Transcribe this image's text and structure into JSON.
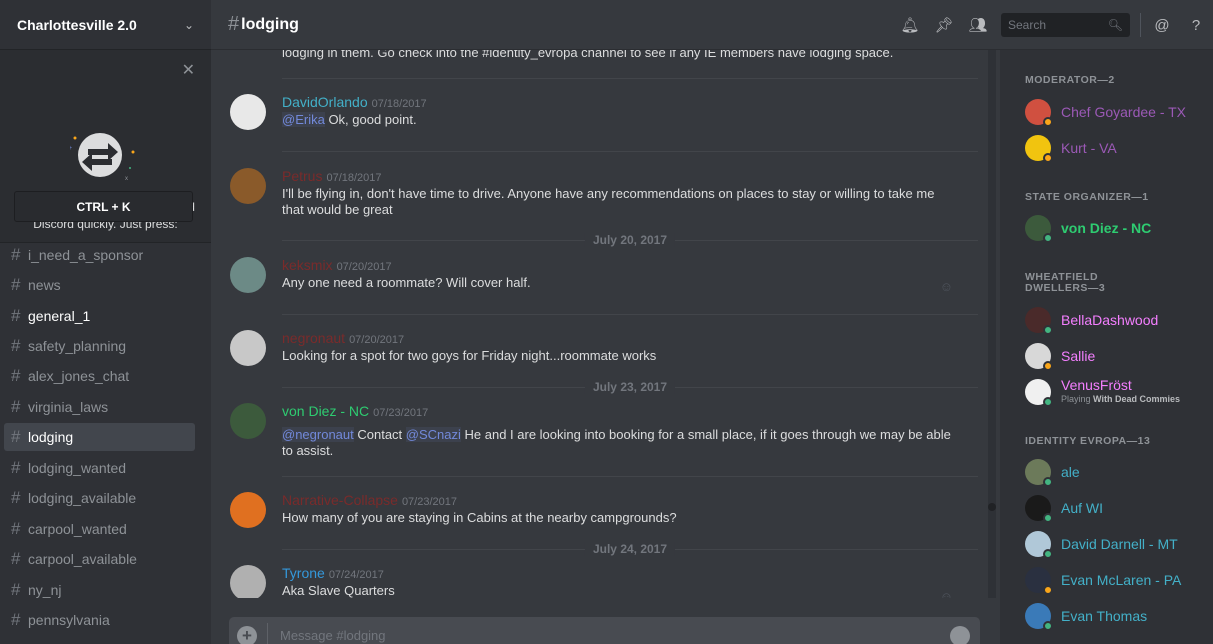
{
  "server": {
    "name": "Charlottesville 2.0"
  },
  "quick_switcher": {
    "text": "Use Quick Switcher to get around Discord quickly. Just press:",
    "shortcut": "CTRL + K"
  },
  "channels": [
    {
      "name": "i_need_a_sponsor",
      "state": "muted"
    },
    {
      "name": "news",
      "state": "muted"
    },
    {
      "name": "general_1",
      "state": "unread"
    },
    {
      "name": "safety_planning",
      "state": "muted"
    },
    {
      "name": "alex_jones_chat",
      "state": "muted"
    },
    {
      "name": "virginia_laws",
      "state": "muted"
    },
    {
      "name": "lodging",
      "state": "active"
    },
    {
      "name": "lodging_wanted",
      "state": "muted"
    },
    {
      "name": "lodging_available",
      "state": "muted"
    },
    {
      "name": "carpool_wanted",
      "state": "muted"
    },
    {
      "name": "carpool_available",
      "state": "muted"
    },
    {
      "name": "ny_nj",
      "state": "muted"
    },
    {
      "name": "pennsylvania",
      "state": "muted"
    }
  ],
  "header": {
    "channel": "lodging",
    "search_placeholder": "Search"
  },
  "messages": {
    "top_text": "lodging in them. Go check into the #identity_evropa channel to see if any IE members have lodging space.",
    "items": [
      {
        "author": "DavidOrlando",
        "color": "#43b0c8",
        "time": "07/18/2017",
        "mention": "@Erika",
        "text": " Ok, good point."
      },
      {
        "author": "Petrus",
        "color": "#7a2b2b",
        "time": "07/18/2017",
        "text": "I'll be flying in, don't have time to drive. Anyone have any recommendations on places to stay or willing to take me that would be great"
      },
      {
        "author": "keksmix",
        "color": "#7a2b2b",
        "time": "07/20/2017",
        "text": "Any one need a roommate? Will cover half."
      },
      {
        "author": "negronaut",
        "color": "#7a2b2b",
        "time": "07/20/2017",
        "text": "Looking for a spot for two goys for Friday night...roommate works"
      },
      {
        "author": "von Diez - NC",
        "color": "#2ecc71",
        "time": "07/23/2017",
        "mention": "@negronaut",
        "text_a": " Contact ",
        "mention2": "@SCnazi",
        "text": "  He and I are looking into booking for a small place, if it goes through we may be able to assist."
      },
      {
        "author": "Narrative-Collapse",
        "color": "#7a2b2b",
        "time": "07/23/2017",
        "text": "How many of you are staying in Cabins at the nearby campgrounds?"
      },
      {
        "author": "Tyrone",
        "color": "#3498db",
        "time": "07/24/2017",
        "text": "Aka Slave Quarters"
      }
    ],
    "dates": [
      "July 20, 2017",
      "July 23, 2017",
      "July 24, 2017"
    ]
  },
  "composer": {
    "placeholder": "Message #lodging"
  },
  "members": {
    "roles": [
      {
        "title": "MODERATOR—2"
      },
      {
        "title": "STATE ORGANIZER—1"
      },
      {
        "title": "WHEATFIELD DWELLERS—3"
      },
      {
        "title": "IDENTITY EVROPA—13"
      }
    ],
    "list": [
      {
        "name": "Chef Goyardee - TX",
        "color": "#9b59b6",
        "status": "#faa61a"
      },
      {
        "name": "Kurt - VA",
        "color": "#9b59b6",
        "status": "#faa61a"
      },
      {
        "name": "von Diez - NC",
        "color": "#2ecc71",
        "status": "#43b581"
      },
      {
        "name": "BellaDashwood",
        "color": "#f47fff",
        "status": "#43b581"
      },
      {
        "name": "Sallie",
        "color": "#f47fff",
        "status": "#faa61a"
      },
      {
        "name": "VenusFröst",
        "color": "#f47fff",
        "status": "#43b581",
        "game_prefix": "Playing ",
        "game": "With Dead Commies"
      },
      {
        "name": "ale",
        "color": "#43b0c8",
        "status": "#43b581"
      },
      {
        "name": "Auf WI",
        "color": "#43b0c8",
        "status": "#43b581"
      },
      {
        "name": "David Darnell - MT",
        "color": "#43b0c8",
        "status": "#43b581"
      },
      {
        "name": "Evan McLaren - PA",
        "color": "#43b0c8",
        "status": "#faa61a"
      },
      {
        "name": "Evan Thomas",
        "color": "#43b0c8",
        "status": "#43b581"
      }
    ]
  }
}
